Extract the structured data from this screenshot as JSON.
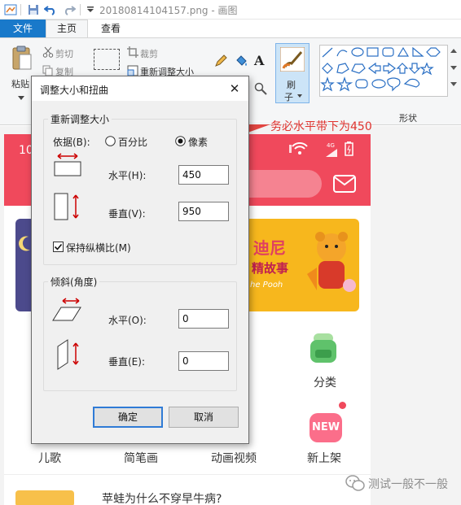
{
  "window": {
    "title": "20180814104157.png - 画图"
  },
  "tabs": {
    "file": "文件",
    "home": "主页",
    "view": "查看"
  },
  "ribbon": {
    "paste": "粘贴",
    "cut": "剪切",
    "copy": "复制",
    "crop": "裁剪",
    "resize": "重新调整大小",
    "brush": "刷",
    "brush_sub": "子",
    "shapes_label": "形状"
  },
  "phone": {
    "status_time": "10",
    "signal": "4G",
    "categories_label": "分类",
    "new_badge": "NEW",
    "new_label": "新上架",
    "bottom_labels": [
      "儿歌",
      "简笔画",
      "动画视频"
    ],
    "banner_text": "迪尼",
    "banner_sub": "精故事",
    "banner_pooh": "he Pooh",
    "bottom_text": "苹蛙为什么不穿早牛病?"
  },
  "annotation": {
    "text": "务必水平带下为450",
    "color": "#e0332e"
  },
  "dialog": {
    "title": "调整大小和扭曲",
    "resize_group": "重新调整大小",
    "basis_label": "依据(B):",
    "option_percent": "百分比",
    "option_pixels": "像素",
    "selected_option": "pixels",
    "horizontal_label": "水平(H):",
    "horizontal_value": "450",
    "vertical_label": "垂直(V):",
    "vertical_value": "950",
    "keep_ratio_label": "保持纵横比(M)",
    "keep_ratio_checked": true,
    "skew_group": "倾斜(角度)",
    "skew_h_label": "水平(O):",
    "skew_h_value": "0",
    "skew_v_label": "垂直(E):",
    "skew_v_value": "0",
    "ok": "确定",
    "cancel": "取消"
  },
  "watermark": {
    "text": "测试一般不一般"
  },
  "colors": {
    "accent_blue": "#1979ca",
    "phone_red": "#f0495c",
    "annotation_red": "#e0332e"
  }
}
